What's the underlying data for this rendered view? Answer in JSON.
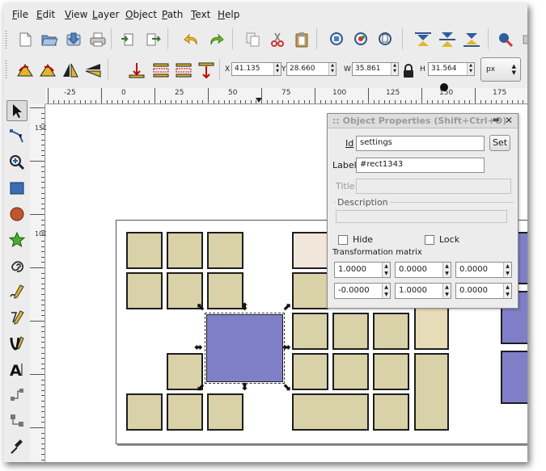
{
  "menubar": {
    "items": [
      {
        "label": "File",
        "accel": "F",
        "rest": "ile"
      },
      {
        "label": "Edit",
        "accel": "E",
        "rest": "dit"
      },
      {
        "label": "View",
        "accel": "V",
        "rest": "iew"
      },
      {
        "label": "Layer",
        "accel": "L",
        "rest": "ayer"
      },
      {
        "label": "Object",
        "accel": "O",
        "rest": "bject"
      },
      {
        "label": "Path",
        "accel": "P",
        "rest": "ath"
      },
      {
        "label": "Text",
        "accel": "T",
        "rest": "ext"
      },
      {
        "label": "Help",
        "accel": "H",
        "rest": "elp"
      }
    ]
  },
  "toolbar": {
    "icons": [
      "new-document-icon",
      "open-folder-icon",
      "save-icon",
      "print-icon",
      "import-icon",
      "export-icon",
      "undo-icon",
      "redo-icon",
      "copy-icon",
      "cut-icon",
      "paste-icon",
      "zoom-selection-icon",
      "zoom-drawing-icon",
      "zoom-page-icon",
      "align-top-icon",
      "align-center-icon",
      "align-bottom-icon",
      "fill-stroke-icon",
      "overflow-icon"
    ]
  },
  "controls": {
    "icons": [
      "rotate-ccw-icon",
      "rotate-cw-icon",
      "flip-horizontal-icon",
      "flip-vertical-icon",
      "raise-to-top-icon",
      "raise-icon",
      "lower-icon",
      "lower-to-bottom-icon"
    ],
    "x_label": "X",
    "x_value": "41.135",
    "y_label": "Y",
    "y_value": "28.660",
    "w_label": "W",
    "w_value": "35.861",
    "h_label": "H",
    "h_value": "31.564",
    "unit": "px"
  },
  "ruler": {
    "h_labels": [
      "-25",
      "0",
      "25",
      "50",
      "75",
      "100",
      "125",
      "150",
      "175"
    ],
    "v_labels": [
      "150",
      "100"
    ]
  },
  "tools": [
    "selector-arrow-icon",
    "node-editor-icon",
    "zoom-tool-icon",
    "rectangle-tool-icon",
    "ellipse-tool-icon",
    "star-tool-icon",
    "spiral-tool-icon",
    "pencil-tool-icon",
    "pen-tool-icon",
    "calligraphy-tool-icon",
    "text-tool-icon",
    "connector-tool-icon",
    "gradient-tool-icon",
    "dropper-tool-icon"
  ],
  "dialog": {
    "title": ":: Object Properties (Shift+Ctrl+O)",
    "id_label": "Id",
    "id_value": "settings",
    "set_button": "Set",
    "label_label": "Label",
    "label_value": "#rect1343",
    "title_label": "Title",
    "description_label": "Description",
    "hide_label": "Hide",
    "lock_label": "Lock",
    "matrix_label": "Transformation matrix",
    "matrix": [
      "1.0000",
      "0.0000",
      "0.0000",
      "-0.0000",
      "1.0000",
      "0.0000"
    ]
  },
  "colors": {
    "tile": "#d9d1a8",
    "tile_light": "#f0e7da",
    "tile_cream": "#e8dcb8",
    "selected": "#7f7fc8"
  }
}
